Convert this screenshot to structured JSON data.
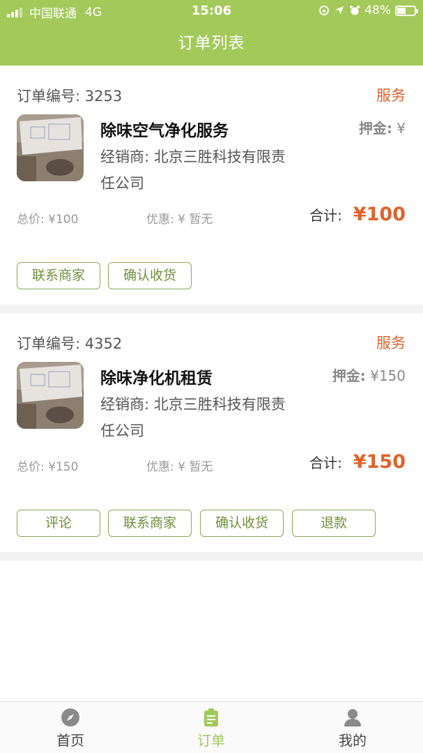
{
  "status_bar": {
    "carrier": "中国联通",
    "network": "4G",
    "time": "15:06",
    "battery": "48%"
  },
  "nav": {
    "title": "订单列表"
  },
  "orders": [
    {
      "number_label": "订单编号: 3253",
      "type": "服务",
      "product_name": "除味空气净化服务",
      "deposit_label": "押金:",
      "deposit_value": "¥",
      "dealer": "经销商: 北京三胜科技有限责任公司",
      "total_price": "总价: ¥100",
      "discount": "优惠: ¥ 暂无",
      "sum_label": "合计:",
      "sum_value": "¥100",
      "buttons": [
        "联系商家",
        "确认收货"
      ]
    },
    {
      "number_label": "订单编号: 4352",
      "type": "服务",
      "product_name": "除味净化机租赁",
      "deposit_label": "押金:",
      "deposit_value": "¥150",
      "dealer": "经销商: 北京三胜科技有限责任公司",
      "total_price": "总价: ¥150",
      "discount": "优惠: ¥ 暂无",
      "sum_label": "合计:",
      "sum_value": "¥150",
      "buttons": [
        "评论",
        "联系商家",
        "确认收货",
        "退款"
      ]
    }
  ],
  "tabbar": {
    "items": [
      {
        "label": "首页",
        "icon": "compass-icon"
      },
      {
        "label": "订单",
        "icon": "clipboard-icon"
      },
      {
        "label": "我的",
        "icon": "user-icon"
      }
    ],
    "active_index": 1
  },
  "colors": {
    "brand": "#a2c95a",
    "accent": "#e0622a",
    "button_border": "#8aa956",
    "button_text": "#6f8f3a"
  }
}
